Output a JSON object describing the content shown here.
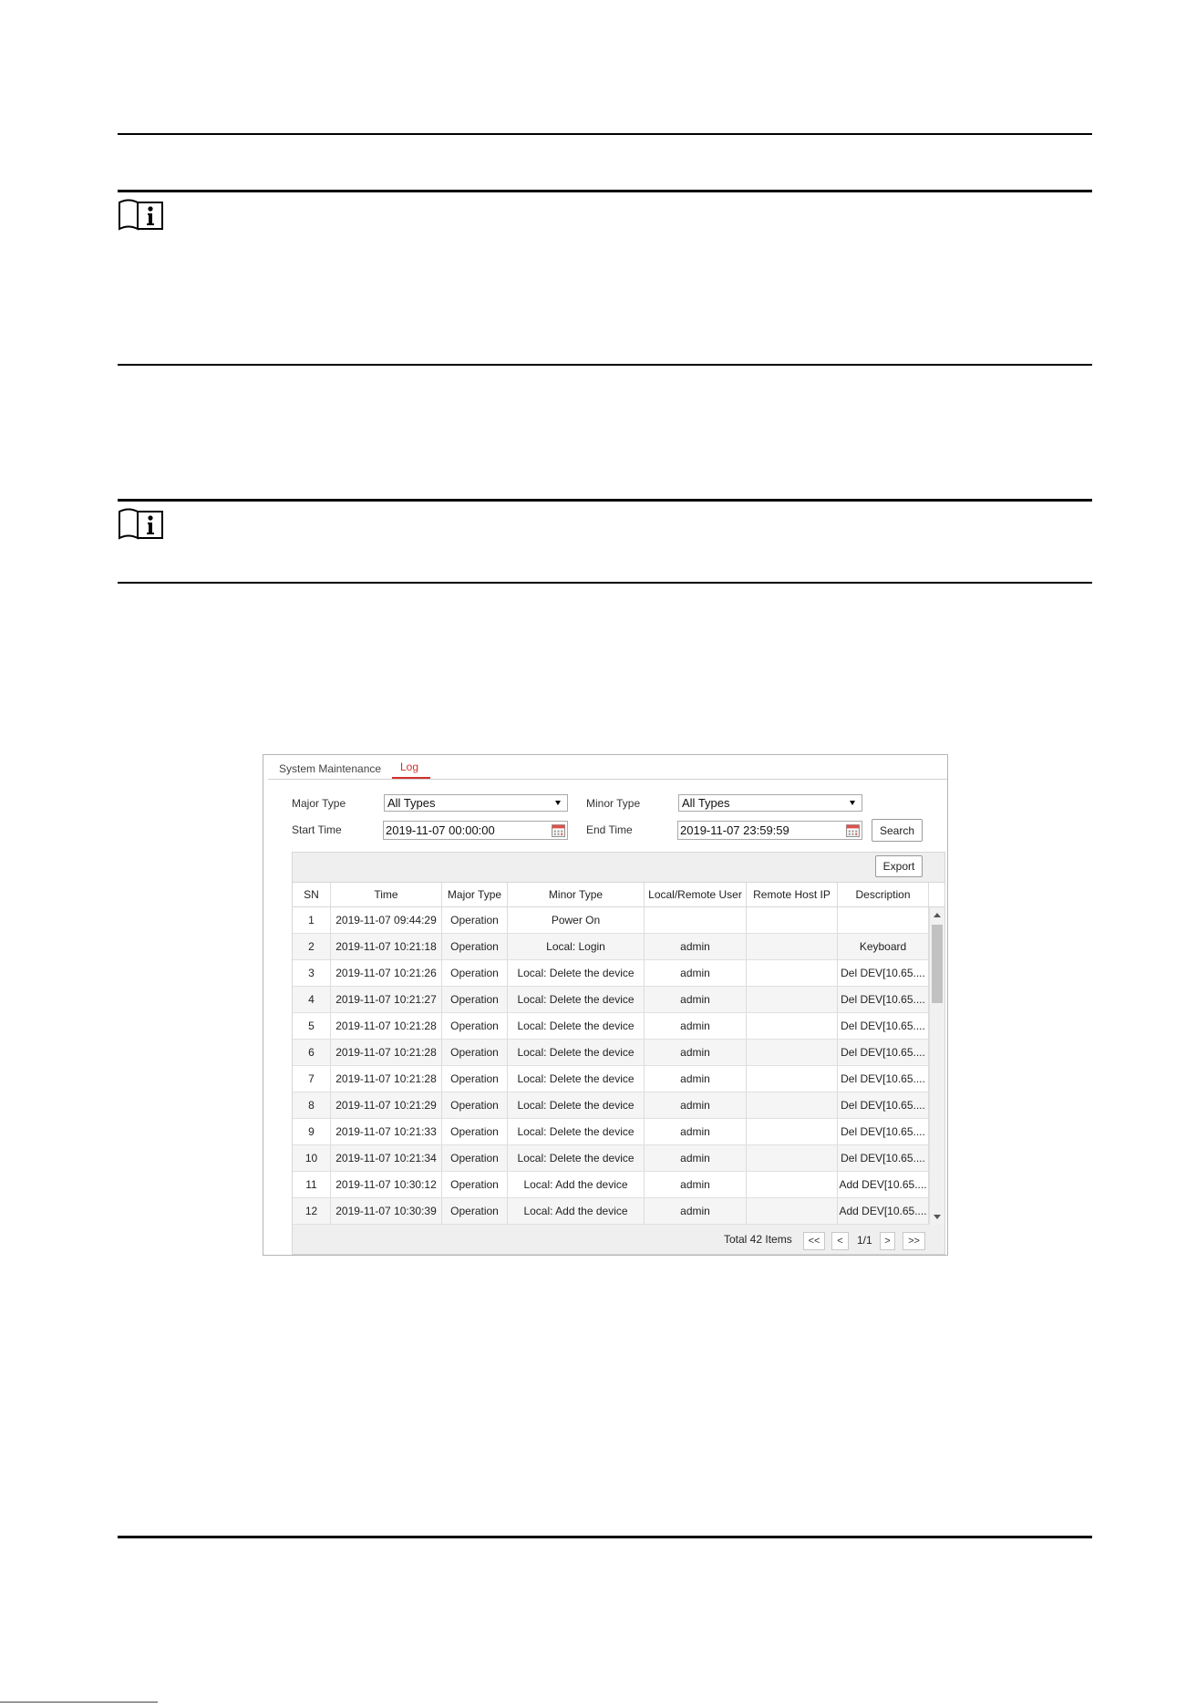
{
  "colors": {
    "rule": "#000000",
    "accent_red": "#d32f2f",
    "panel_border": "#b5b5b5",
    "grid_bg": "#efefef",
    "row_alt": "#f5f5f5"
  },
  "icons": {
    "note": "note-icon",
    "calendar": "calendar-icon",
    "dropdown": "dropdown-arrow-icon",
    "scroll_up": "scroll-up-icon",
    "scroll_down": "scroll-down-icon"
  },
  "log_panel": {
    "tabs": [
      {
        "label": "System Maintenance",
        "active": false
      },
      {
        "label": "Log",
        "active": true
      }
    ],
    "filters": {
      "major_type_label": "Major Type",
      "major_type_value": "All Types",
      "minor_type_label": "Minor Type",
      "minor_type_value": "All Types",
      "start_time_label": "Start Time",
      "start_time_value": "2019-11-07 00:00:00",
      "end_time_label": "End Time",
      "end_time_value": "2019-11-07 23:59:59",
      "search_label": "Search"
    },
    "export_label": "Export",
    "table": {
      "columns": [
        "SN",
        "Time",
        "Major Type",
        "Minor Type",
        "Local/Remote User",
        "Remote Host IP",
        "Description"
      ],
      "rows": [
        {
          "sn": "1",
          "time": "2019-11-07 09:44:29",
          "major": "Operation",
          "minor": "Power On",
          "user": "",
          "ip": "",
          "desc": ""
        },
        {
          "sn": "2",
          "time": "2019-11-07 10:21:18",
          "major": "Operation",
          "minor": "Local: Login",
          "user": "admin",
          "ip": "",
          "desc": "Keyboard"
        },
        {
          "sn": "3",
          "time": "2019-11-07 10:21:26",
          "major": "Operation",
          "minor": "Local: Delete the device",
          "user": "admin",
          "ip": "",
          "desc": "Del DEV[10.65...."
        },
        {
          "sn": "4",
          "time": "2019-11-07 10:21:27",
          "major": "Operation",
          "minor": "Local: Delete the device",
          "user": "admin",
          "ip": "",
          "desc": "Del DEV[10.65...."
        },
        {
          "sn": "5",
          "time": "2019-11-07 10:21:28",
          "major": "Operation",
          "minor": "Local: Delete the device",
          "user": "admin",
          "ip": "",
          "desc": "Del DEV[10.65...."
        },
        {
          "sn": "6",
          "time": "2019-11-07 10:21:28",
          "major": "Operation",
          "minor": "Local: Delete the device",
          "user": "admin",
          "ip": "",
          "desc": "Del DEV[10.65...."
        },
        {
          "sn": "7",
          "time": "2019-11-07 10:21:28",
          "major": "Operation",
          "minor": "Local: Delete the device",
          "user": "admin",
          "ip": "",
          "desc": "Del DEV[10.65...."
        },
        {
          "sn": "8",
          "time": "2019-11-07 10:21:29",
          "major": "Operation",
          "minor": "Local: Delete the device",
          "user": "admin",
          "ip": "",
          "desc": "Del DEV[10.65...."
        },
        {
          "sn": "9",
          "time": "2019-11-07 10:21:33",
          "major": "Operation",
          "minor": "Local: Delete the device",
          "user": "admin",
          "ip": "",
          "desc": "Del DEV[10.65...."
        },
        {
          "sn": "10",
          "time": "2019-11-07 10:21:34",
          "major": "Operation",
          "minor": "Local: Delete the device",
          "user": "admin",
          "ip": "",
          "desc": "Del DEV[10.65...."
        },
        {
          "sn": "11",
          "time": "2019-11-07 10:30:12",
          "major": "Operation",
          "minor": "Local: Add the device",
          "user": "admin",
          "ip": "",
          "desc": "Add DEV[10.65...."
        },
        {
          "sn": "12",
          "time": "2019-11-07 10:30:39",
          "major": "Operation",
          "minor": "Local: Add the device",
          "user": "admin",
          "ip": "",
          "desc": "Add DEV[10.65...."
        }
      ]
    },
    "pagination": {
      "total": "Total 42 Items",
      "first": "<<",
      "prev": "<",
      "page": "1/1",
      "next": ">",
      "last": ">>"
    }
  }
}
